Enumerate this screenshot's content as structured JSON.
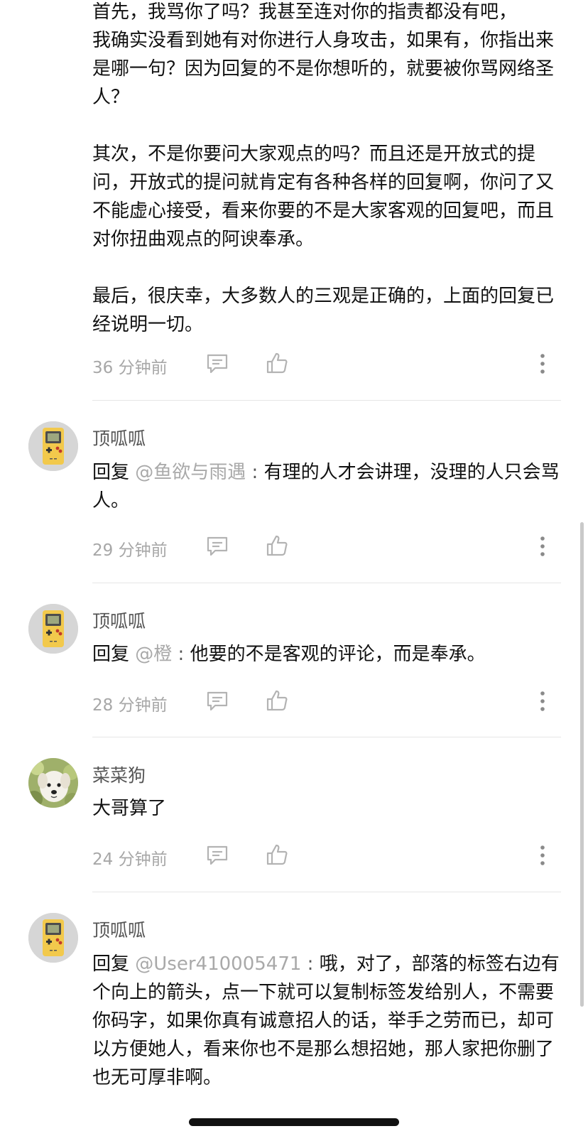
{
  "comments": [
    {
      "body": "首先，我骂你了吗？我甚至连对你的指责都没有吧，\n我确实没看到她有对你进行人身攻击，如果有，你指出来是哪一句？因为回复的不是你想听的，就要被你骂网络圣人？\n\n其次，不是你要问大家观点的吗？而且还是开放式的提问，开放式的提问就肯定有各种各样的回复啊，你问了又不能虚心接受，看来你要的不是大家客观的回复吧，而且对你扭曲观点的阿谀奉承。\n\n最后，很庆幸，大多数人的三观是正确的，上面的回复已经说明一切。",
      "time": "36 分钟前"
    },
    {
      "username": "顶呱呱",
      "reply_prefix": "回复 ",
      "mention": "@鱼欲与雨遇",
      "separator": " : ",
      "text": "有理的人才会讲理，没理的人只会骂人。",
      "time": "29 分钟前",
      "avatar": "gameboy-avatar"
    },
    {
      "username": "顶呱呱",
      "reply_prefix": "回复 ",
      "mention": "@橙",
      "separator": " : ",
      "text": "他要的不是客观的评论，而是奉承。",
      "time": "28 分钟前",
      "avatar": "gameboy-avatar"
    },
    {
      "username": "菜菜狗",
      "text": "大哥算了",
      "time": "24 分钟前",
      "avatar": "dog-avatar"
    },
    {
      "username": "顶呱呱",
      "reply_prefix": "回复 ",
      "mention": "@User410005471",
      "separator": " : ",
      "text": "哦，对了，部落的标签右边有个向上的箭头，点一下就可以复制标签发给别人，不需要你码字，如果你真有诚意招人的话，举手之劳而已，却可以方便她人，看来你也不是那么想招她，那人家把你删了也无可厚非啊。",
      "avatar": "gameboy-avatar"
    }
  ],
  "colors": {
    "text": "#111111",
    "muted": "#a7a7a7",
    "mention": "#a9a9a9",
    "username": "#555555",
    "divider": "#e6e6e6",
    "gameboy_body": "#f2c94c"
  },
  "icons": {
    "reply": "comment-icon",
    "like": "thumbs-up-icon",
    "more": "more-vertical-icon"
  }
}
